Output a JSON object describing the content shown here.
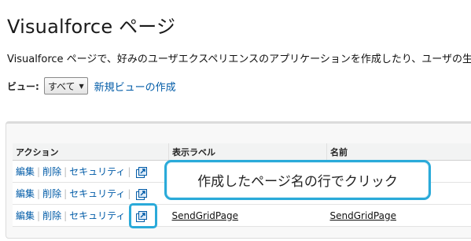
{
  "page": {
    "title": "Visualforce ページ",
    "description": "Visualforce ページで、好みのユーザエクスペリエンスのアプリケーションを作成したり、ユーザの生産性"
  },
  "view": {
    "label": "ビュー:",
    "selected": "すべて",
    "new_view_link": "新規ビューの作成"
  },
  "table": {
    "headers": [
      "アクション",
      "表示ラベル",
      "名前"
    ],
    "action_labels": {
      "edit": "編集",
      "delete": "削除",
      "security": "セキュリティ"
    },
    "rows": [
      {
        "label": "",
        "name": ""
      },
      {
        "label": "",
        "name": ""
      },
      {
        "label": "SendGridPage",
        "name": "SendGridPage"
      }
    ]
  },
  "callout": {
    "text": "作成したページ名の行でクリック"
  },
  "colors": {
    "link": "#015ba7",
    "highlight": "#2aaad9"
  }
}
